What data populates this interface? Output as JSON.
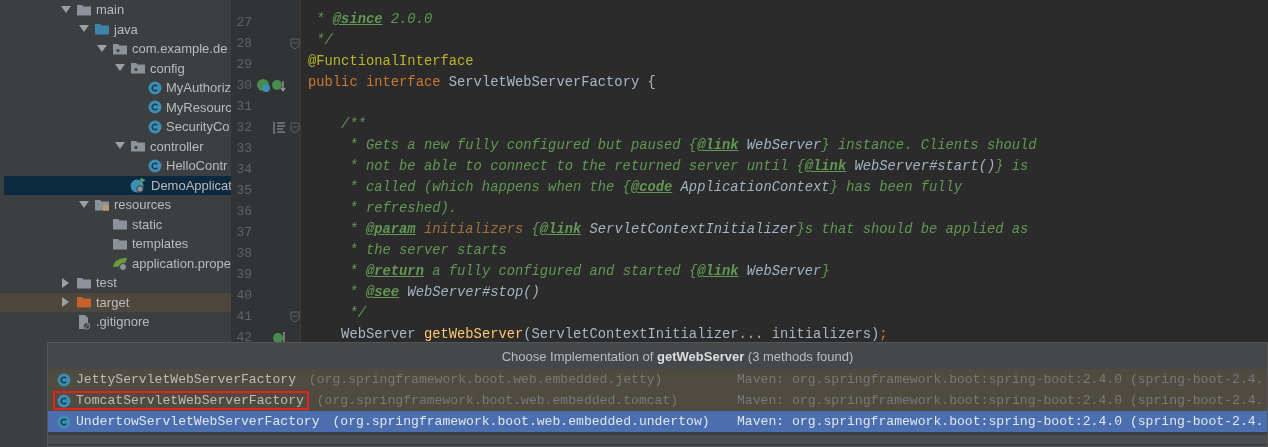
{
  "project_tree": [
    {
      "label": "main",
      "kind": "folder",
      "expanded": true,
      "selected": false,
      "highlighted": false,
      "children": [
        {
          "label": "java",
          "kind": "source-folder",
          "expanded": true,
          "selected": false,
          "highlighted": false,
          "children": [
            {
              "label": "com.example.de",
              "kind": "package",
              "expanded": true,
              "selected": false,
              "highlighted": false,
              "children": [
                {
                  "label": "config",
                  "kind": "package",
                  "expanded": true,
                  "selected": false,
                  "highlighted": false,
                  "children": [
                    {
                      "label": "MyAuthoriz",
                      "kind": "class",
                      "selected": false,
                      "highlighted": false
                    },
                    {
                      "label": "MyResourc",
                      "kind": "class",
                      "selected": false,
                      "highlighted": false
                    },
                    {
                      "label": "SecurityCo",
                      "kind": "class",
                      "selected": false,
                      "highlighted": false
                    }
                  ]
                },
                {
                  "label": "controller",
                  "kind": "package",
                  "expanded": true,
                  "selected": false,
                  "highlighted": false,
                  "children": [
                    {
                      "label": "HelloContr",
                      "kind": "class",
                      "selected": false,
                      "highlighted": false
                    }
                  ]
                },
                {
                  "label": "DemoApplicat",
                  "kind": "app-class",
                  "selected": true,
                  "highlighted": false
                }
              ]
            }
          ]
        },
        {
          "label": "resources",
          "kind": "resources-folder",
          "expanded": true,
          "selected": false,
          "highlighted": false,
          "children": [
            {
              "label": "static",
              "kind": "folder",
              "selected": false,
              "highlighted": false
            },
            {
              "label": "templates",
              "kind": "folder",
              "selected": false,
              "highlighted": false
            },
            {
              "label": "application.prope",
              "kind": "properties",
              "selected": false,
              "highlighted": false
            }
          ]
        }
      ]
    },
    {
      "label": "test",
      "kind": "folder",
      "expanded": false,
      "selected": false,
      "highlighted": false
    },
    {
      "label": "target",
      "kind": "excluded-folder",
      "expanded": false,
      "selected": false,
      "highlighted": true
    },
    {
      "label": ".gitignore",
      "kind": "ignored-file",
      "selected": false,
      "highlighted": false
    }
  ],
  "editor": {
    "lines": [
      {
        "number": "27",
        "tokens": [
          {
            "kind": "comment",
            "text": " * "
          },
          {
            "kind": "tag",
            "text": "@since"
          },
          {
            "kind": "comment",
            "text": " 2.0.0"
          }
        ]
      },
      {
        "number": "28",
        "gutter": [
          {
            "kind": "fold"
          }
        ],
        "tokens": [
          {
            "kind": "comment",
            "text": " */"
          }
        ]
      },
      {
        "number": "29",
        "tokens": [
          {
            "kind": "annotation",
            "text": "@FunctionalInterface"
          }
        ]
      },
      {
        "number": "30",
        "gutter": [
          {
            "kind": "implemented"
          }
        ],
        "tokens": [
          {
            "kind": "keyword",
            "text": "public interface "
          },
          {
            "kind": "plain",
            "text": "ServletWebServerFactory {"
          }
        ]
      },
      {
        "number": "31"
      },
      {
        "number": "32",
        "gutter": [
          {
            "kind": "doc"
          },
          {
            "kind": "fold"
          }
        ],
        "tokens": [
          {
            "kind": "comment",
            "text": "    /**"
          }
        ]
      },
      {
        "number": "33",
        "tokens": [
          {
            "kind": "comment",
            "text": "     * Gets a new fully configured but paused {"
          },
          {
            "kind": "tag",
            "text": "@link"
          },
          {
            "kind": "ref",
            "text": " WebServer"
          },
          {
            "kind": "comment",
            "text": "} instance. Clients should"
          }
        ]
      },
      {
        "number": "34",
        "tokens": [
          {
            "kind": "comment",
            "text": "     * not be able to connect to the returned server until {"
          },
          {
            "kind": "tag",
            "text": "@link"
          },
          {
            "kind": "ref",
            "text": " WebServer#start()"
          },
          {
            "kind": "comment",
            "text": "} is"
          }
        ]
      },
      {
        "number": "35",
        "tokens": [
          {
            "kind": "comment",
            "text": "     * called (which happens when the {"
          },
          {
            "kind": "tag",
            "text": "@code"
          },
          {
            "kind": "ref",
            "text": " ApplicationContext"
          },
          {
            "kind": "comment",
            "text": "} has been fully"
          }
        ]
      },
      {
        "number": "36",
        "tokens": [
          {
            "kind": "comment",
            "text": "     * refreshed)."
          }
        ]
      },
      {
        "number": "37",
        "tokens": [
          {
            "kind": "comment",
            "text": "     * "
          },
          {
            "kind": "tag",
            "text": "@param"
          },
          {
            "kind": "param",
            "text": " initializers"
          },
          {
            "kind": "comment",
            "text": " {"
          },
          {
            "kind": "tag",
            "text": "@link"
          },
          {
            "kind": "ref",
            "text": " ServletContextInitializer"
          },
          {
            "kind": "comment",
            "text": "}s that should be applied as"
          }
        ]
      },
      {
        "number": "38",
        "tokens": [
          {
            "kind": "comment",
            "text": "     * the server starts"
          }
        ]
      },
      {
        "number": "39",
        "tokens": [
          {
            "kind": "comment",
            "text": "     * "
          },
          {
            "kind": "tag",
            "text": "@return"
          },
          {
            "kind": "comment",
            "text": " a fully configured and started {"
          },
          {
            "kind": "tag",
            "text": "@link"
          },
          {
            "kind": "ref",
            "text": " WebServer"
          },
          {
            "kind": "comment",
            "text": "}"
          }
        ]
      },
      {
        "number": "40",
        "tokens": [
          {
            "kind": "comment",
            "text": "     * "
          },
          {
            "kind": "tag",
            "text": "@see"
          },
          {
            "kind": "ref",
            "text": " WebServer#stop()"
          }
        ]
      },
      {
        "number": "41",
        "gutter": [
          {
            "kind": "fold"
          }
        ],
        "tokens": [
          {
            "kind": "comment",
            "text": "     */"
          }
        ]
      },
      {
        "number": "42",
        "gutter": [
          {
            "kind": "implements"
          }
        ],
        "tokens": [
          {
            "kind": "plain",
            "text": "    WebServer "
          },
          {
            "kind": "method",
            "text": "getWebServer"
          },
          {
            "kind": "plain",
            "text": "(ServletContextInitializer... initializers)"
          },
          {
            "kind": "keyword",
            "text": ";"
          }
        ]
      }
    ]
  },
  "popup": {
    "title": "Choose Implementation of **getWebServer** (3 methods found)",
    "rows": [
      {
        "name": "JettyServletWebServerFactory",
        "package": "(org.springframework.boot.web.embedded.jetty)",
        "location": "Maven: org.springframework.boot:spring-boot:2.4.0 (spring-boot-2.4.",
        "selected": false,
        "annotated": false
      },
      {
        "name": "TomcatServletWebServerFactory",
        "package": "(org.springframework.boot.web.embedded.tomcat)",
        "location": "Maven: org.springframework.boot:spring-boot:2.4.0 (spring-boot-2.4.",
        "selected": false,
        "annotated": true
      },
      {
        "name": "UndertowServletWebServerFactory",
        "package": "(org.springframework.boot.web.embedded.undertow)",
        "location": "Maven: org.springframework.boot:spring-boot:2.4.0 (spring-boot-2.4.",
        "selected": true,
        "annotated": false
      }
    ]
  }
}
